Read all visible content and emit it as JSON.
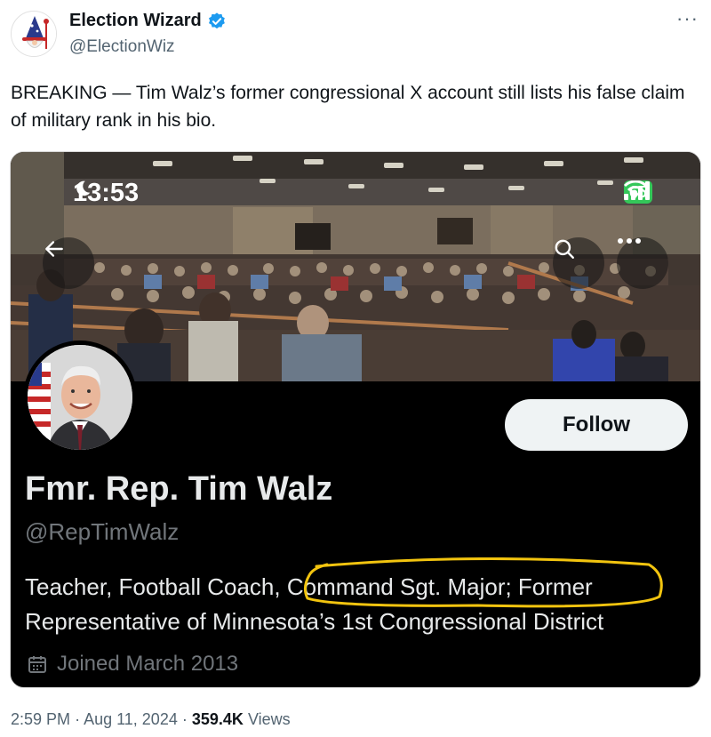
{
  "author": {
    "name": "Election Wizard",
    "handle": "@ElectionWiz",
    "verified": true
  },
  "tweet": {
    "text": "BREAKING — Tim Walz’s former congressional X account still lists his false claim of military rank in his bio.",
    "time": "2:59 PM",
    "separator": "·",
    "date": "Aug 11, 2024",
    "views_count": "359.4K",
    "views_label": "Views"
  },
  "screenshot": {
    "status_time": "13:53",
    "battery": "65",
    "profile": {
      "display_name": "Fmr. Rep. Tim Walz",
      "handle": "@RepTimWalz",
      "bio": "Teacher, Football Coach, Command Sgt. Major; Former Representative of Minnesota’s 1st Congressional District",
      "joined": "Joined March 2013",
      "follow_label": "Follow"
    }
  },
  "colors": {
    "highlight": "#f2c40f",
    "verified": "#1d9bf0",
    "battery": "#34c759"
  }
}
